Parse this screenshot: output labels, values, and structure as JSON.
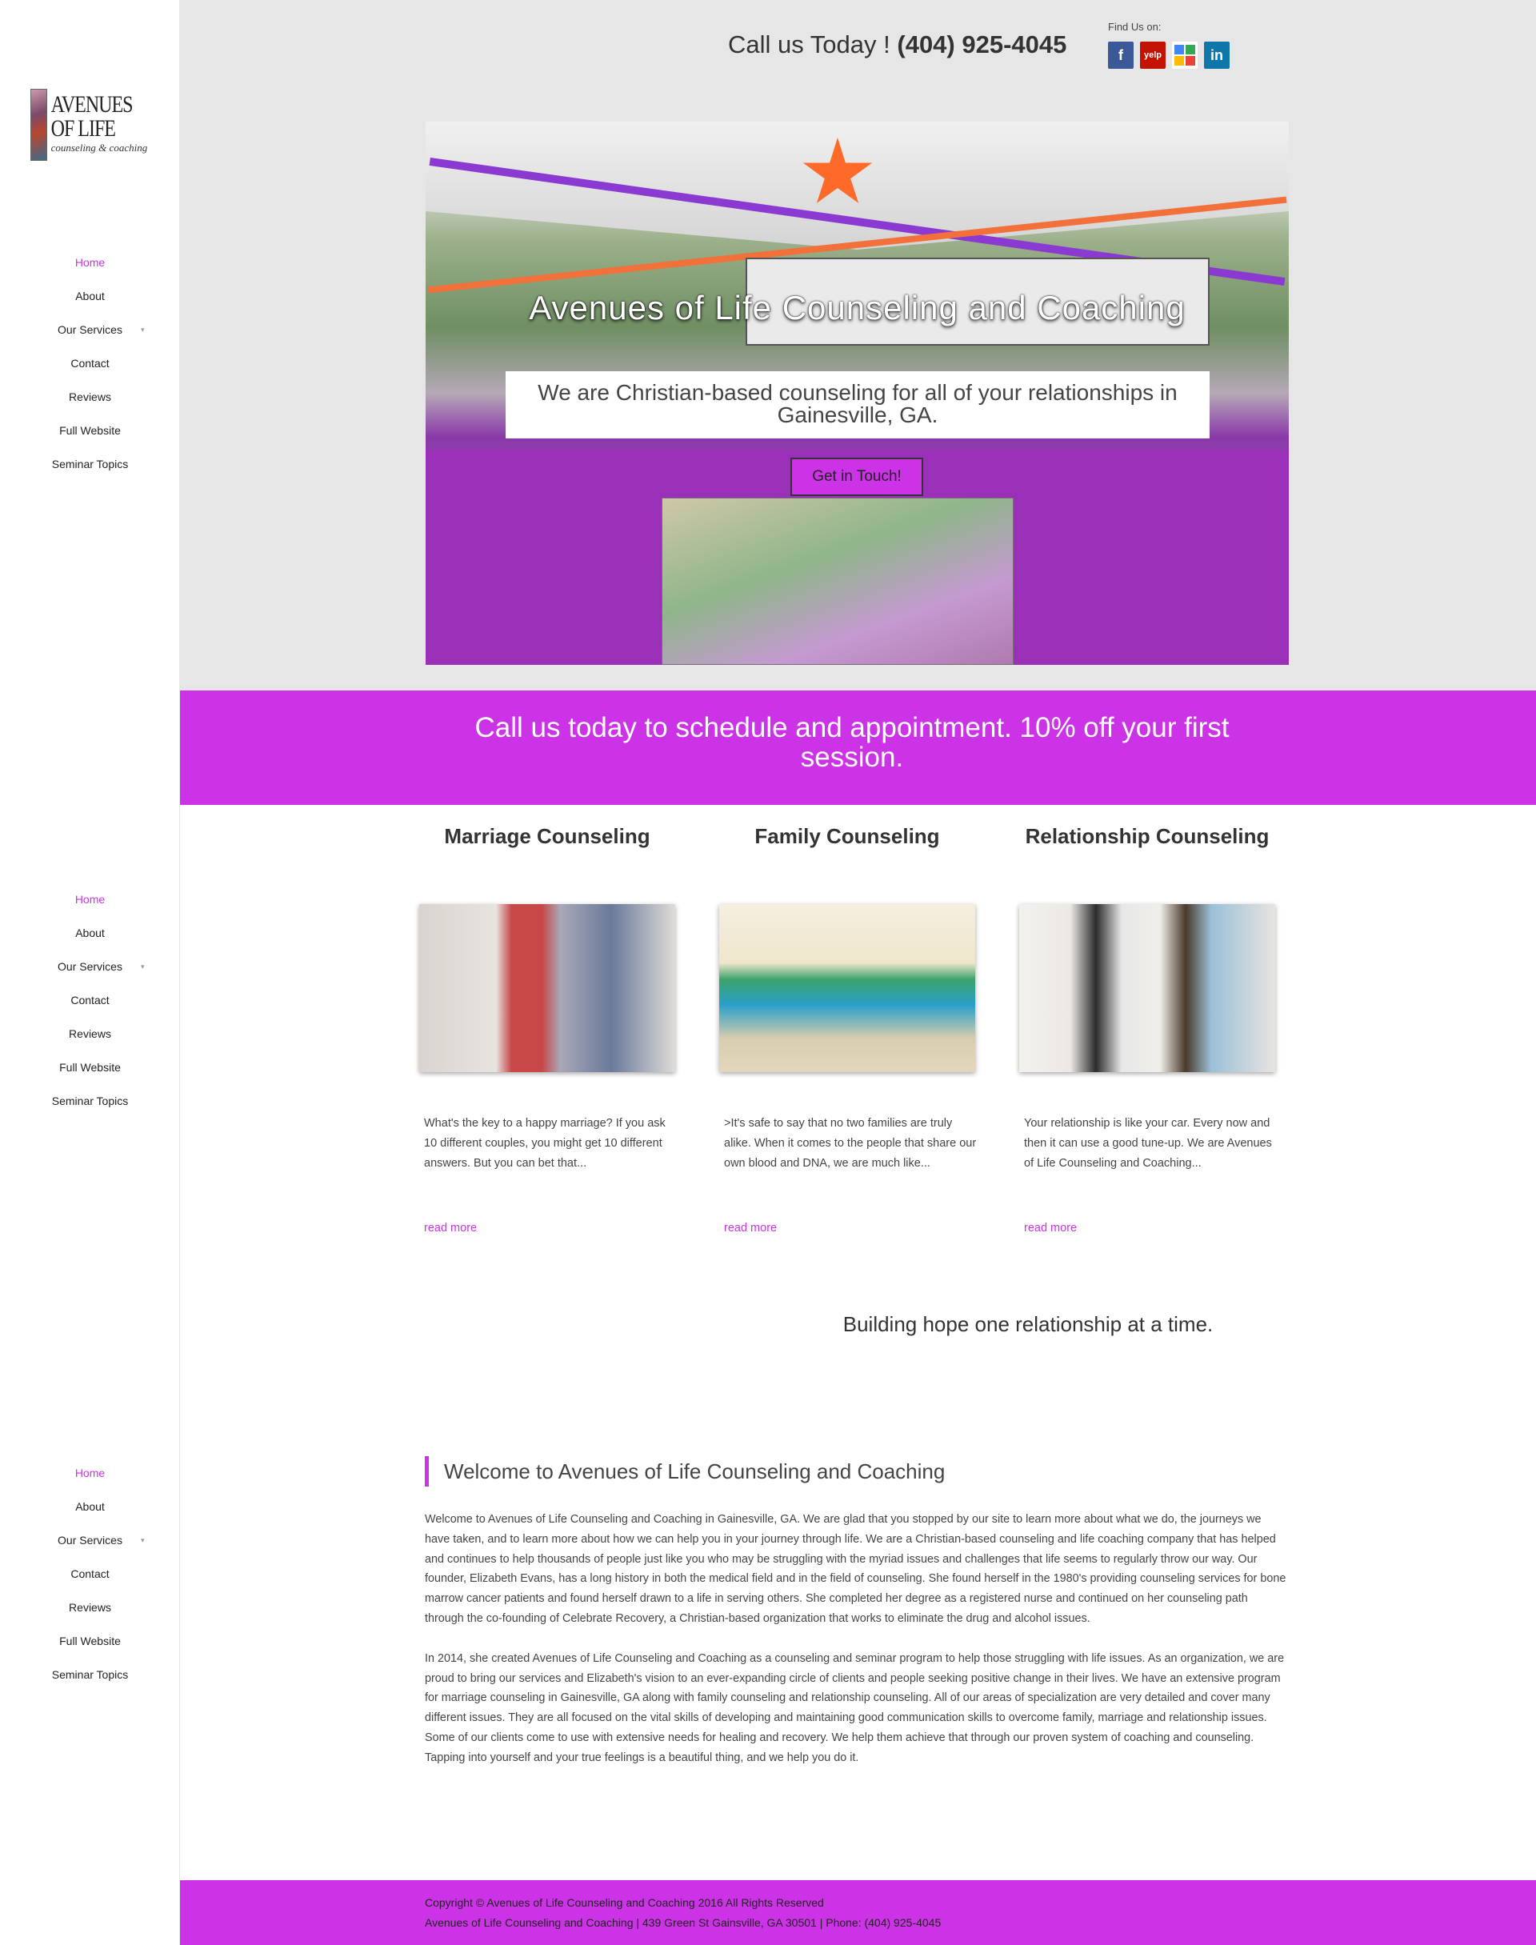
{
  "logo": {
    "line1": "AVENUES OF LIFE",
    "line2": "counseling & coaching"
  },
  "nav": {
    "items": [
      {
        "label": "Home",
        "active": true
      },
      {
        "label": "About"
      },
      {
        "label": "Our Services",
        "dropdown": true
      },
      {
        "label": "Contact"
      },
      {
        "label": "Reviews"
      },
      {
        "label": "Full Website"
      },
      {
        "label": "Seminar Topics"
      }
    ]
  },
  "header": {
    "call_prefix": "Call us Today ! ",
    "phone": "(404) 925-4045",
    "find_us": "Find Us on:",
    "social": [
      {
        "icon": "facebook-icon",
        "glyph": "f"
      },
      {
        "icon": "yelp-icon",
        "glyph": "yelp"
      },
      {
        "icon": "google-plus-icon",
        "glyph": "g+"
      },
      {
        "icon": "linkedin-icon",
        "glyph": "in"
      }
    ]
  },
  "hero": {
    "title": "Avenues of Life Counseling and Coaching",
    "subtitle": "We are Christian-based counseling for all of your relationships in Gainesville, GA.",
    "button": "Get in Touch!"
  },
  "promo": {
    "text": "Call us today to schedule and appointment. 10% off your first session."
  },
  "services": [
    {
      "title": "Marriage Counseling",
      "desc": "What's the key to a happy marriage? If you ask 10 different couples, you might get 10 different answers. But you can bet that...",
      "more": "read more"
    },
    {
      "title": "Family Counseling",
      "desc": ">It's safe to say that no two families are truly alike. When it comes to the people that share our own blood and DNA, we are much like...",
      "more": "read more"
    },
    {
      "title": "Relationship Counseling",
      "desc": "Your relationship is like your car. Every now and then it can use a good tune-up. We are Avenues of Life Counseling and Coaching...",
      "more": "read more"
    }
  ],
  "tagline": "Building hope one relationship at a time.",
  "welcome": {
    "heading": "Welcome to Avenues of Life Counseling and Coaching",
    "p1": "Welcome to Avenues of Life Counseling and Coaching in Gainesville, GA. We are glad that you stopped by our site to learn more about what we do, the journeys we have taken, and to learn more about how we can help you in your journey through life. We are a Christian-based counseling and life coaching company that has helped and continues to help thousands of people just like you who may be struggling with the myriad issues and challenges that life seems to regularly throw our way. Our founder, Elizabeth Evans, has a long history in both the medical field and in the field of counseling. She found herself in the 1980's providing counseling services for bone marrow cancer patients and found herself drawn to a life in serving others. She completed her degree as a registered nurse and continued on her counseling path through the co-founding of Celebrate Recovery, a Christian-based organization that works to eliminate the drug and alcohol issues.",
    "p2": "In 2014, she created Avenues of Life Counseling and Coaching as a counseling and seminar program to help those struggling with life issues. As an organization, we are proud to bring our services and Elizabeth's vision to an ever-expanding circle of clients and people seeking positive change in their lives. We have an extensive program for marriage counseling in Gainesville, GA along with family counseling and relationship counseling. All of our areas of specialization are very detailed and cover many different issues. They are all focused on the vital skills of developing and maintaining good communication skills to overcome family, marriage and relationship issues. Some of our clients come to use with extensive needs for healing and recovery. We help them achieve that through our proven system of coaching and counseling. Tapping into yourself and your true feelings is a beautiful thing, and we help you do it."
  },
  "footer": {
    "copyright": "Copyright © Avenues of Life Counseling and Coaching 2016 All Rights Reserved",
    "address": "Avenues of Life Counseling and Coaching | 439 Green St Gainsville, GA 30501 | Phone: (404) 925-4045"
  },
  "colors": {
    "accent": "#cc33e6",
    "band": "#e6e6e6"
  }
}
